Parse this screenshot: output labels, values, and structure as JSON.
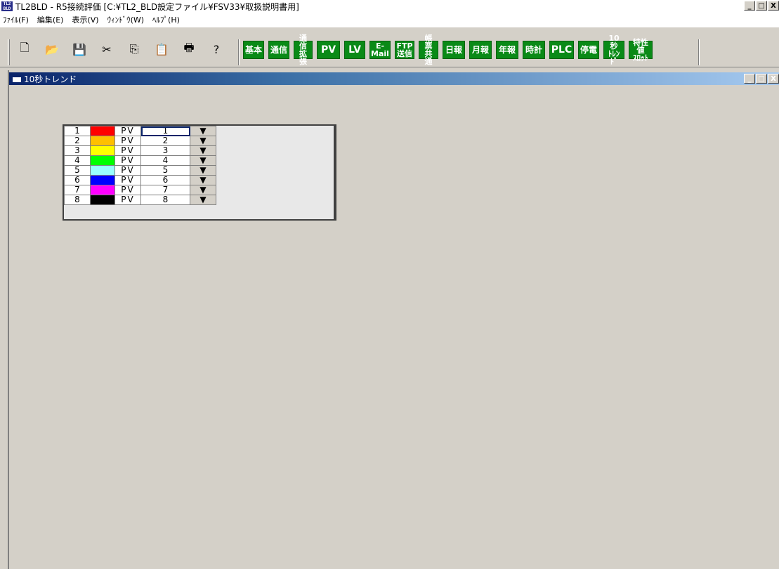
{
  "window": {
    "icon_text": "TL2\nBLD",
    "title": "TL2BLD - R5接続評価 [C:¥TL2_BLD設定ファイル¥FSV33¥取扱説明書用]",
    "minimize": "_",
    "maximize": "□",
    "close": "X"
  },
  "menu": [
    {
      "label": "ﾌｧｲﾙ(F)"
    },
    {
      "label": "編集(E)"
    },
    {
      "label": "表示(V)"
    },
    {
      "label": "ｳｨﾝﾄﾞｳ(W)"
    },
    {
      "label": "ﾍﾙﾌﾟ(H)"
    }
  ],
  "toolbar": {
    "standard": [
      {
        "icon": "new-file-icon",
        "glyph": "🗋"
      },
      {
        "icon": "open-folder-icon",
        "glyph": "📂"
      },
      {
        "icon": "save-icon",
        "glyph": "💾"
      },
      {
        "icon": "cut-icon",
        "glyph": "✂"
      },
      {
        "icon": "copy-icon",
        "glyph": "⎘"
      },
      {
        "icon": "paste-icon",
        "glyph": "📋"
      },
      {
        "icon": "print-icon",
        "glyph": "🖶"
      },
      {
        "icon": "help-icon",
        "glyph": "?"
      }
    ],
    "green_buttons": [
      {
        "label": "基本",
        "style": "med"
      },
      {
        "label": "通信",
        "style": "med"
      },
      {
        "label": "通信\n拡張",
        "style": "small"
      },
      {
        "label": "PV",
        "style": "big"
      },
      {
        "label": "LV",
        "style": "big"
      },
      {
        "label": "E-\nMail",
        "style": "small"
      },
      {
        "label": "FTP\n送信",
        "style": "small"
      },
      {
        "label": "帳票\n共通",
        "style": "small"
      },
      {
        "label": "日報",
        "style": "med"
      },
      {
        "label": "月報",
        "style": "med"
      },
      {
        "label": "年報",
        "style": "med"
      },
      {
        "label": "時計",
        "style": "med"
      },
      {
        "label": "PLC",
        "style": "big"
      },
      {
        "label": "停電",
        "style": "med"
      },
      {
        "label": "10秒\nﾄﾚﾝﾄﾞ",
        "style": "small"
      },
      {
        "label": "特性値\nｽﾛｯﾄ",
        "style": "small"
      }
    ],
    "green_color": "#0a8a17"
  },
  "child_window": {
    "title": "10秒トレンド",
    "minimize": "_",
    "maximize": "□",
    "close": "X"
  },
  "trend_rows": [
    {
      "num": "1",
      "color": "#ff0000",
      "type": "PV",
      "value": "1",
      "dropdown": "▼"
    },
    {
      "num": "2",
      "color": "#ffc000",
      "type": "PV",
      "value": "2",
      "dropdown": "▼"
    },
    {
      "num": "3",
      "color": "#ffff00",
      "type": "PV",
      "value": "3",
      "dropdown": "▼"
    },
    {
      "num": "4",
      "color": "#00ff00",
      "type": "PV",
      "value": "4",
      "dropdown": "▼"
    },
    {
      "num": "5",
      "color": "#99ffff",
      "type": "PV",
      "value": "5",
      "dropdown": "▼"
    },
    {
      "num": "6",
      "color": "#0000ff",
      "type": "PV",
      "value": "6",
      "dropdown": "▼"
    },
    {
      "num": "7",
      "color": "#ff00ff",
      "type": "PV",
      "value": "7",
      "dropdown": "▼"
    },
    {
      "num": "8",
      "color": "#000000",
      "type": "PV",
      "value": "8",
      "dropdown": "▼"
    }
  ]
}
